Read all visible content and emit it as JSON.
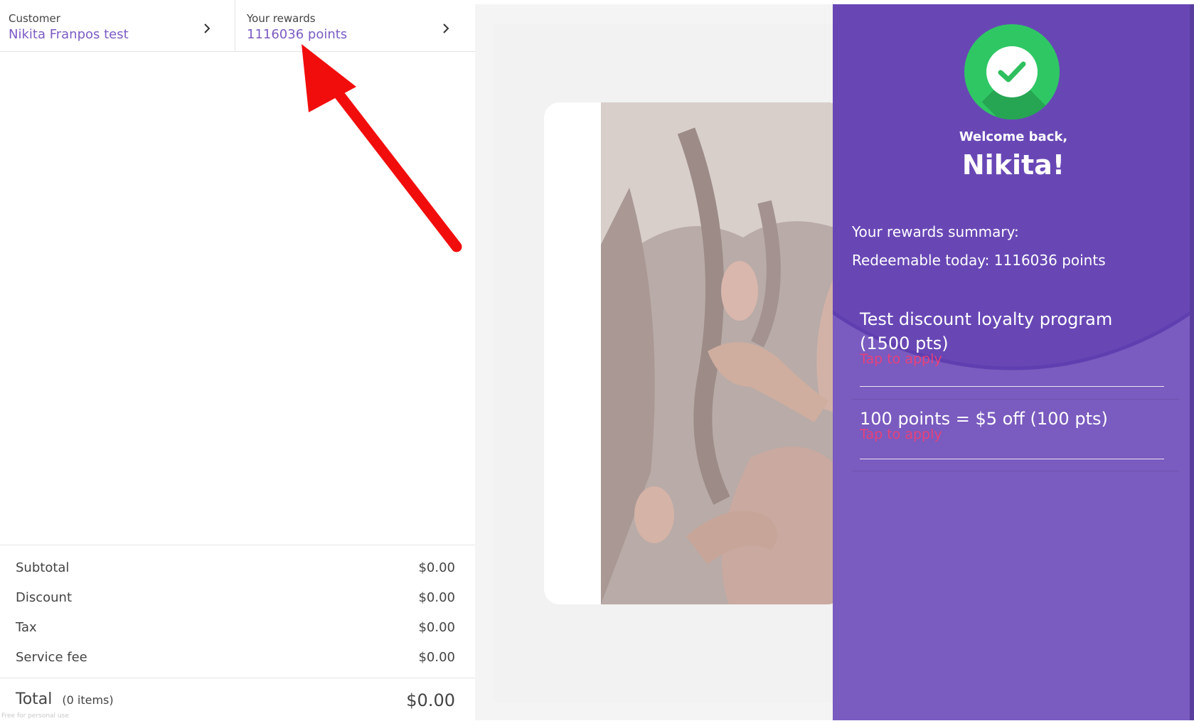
{
  "header": {
    "customer_label": "Customer",
    "customer_name": "Nikita Franpos test",
    "rewards_label": "Your rewards",
    "rewards_points": "1116036 points"
  },
  "totals": {
    "subtotal_label": "Subtotal",
    "subtotal_value": "$0.00",
    "discount_label": "Discount",
    "discount_value": "$0.00",
    "tax_label": "Tax",
    "tax_value": "$0.00",
    "service_label": "Service fee",
    "service_value": "$0.00",
    "total_label": "Total",
    "total_items": "(0 items)",
    "total_value": "$0.00"
  },
  "footer_note": "Free for personal use",
  "panel": {
    "welcome": "Welcome back,",
    "name": "Nikita!",
    "summary": "Your rewards summary:",
    "redeemable": "Redeemable today: 1116036 points",
    "rewards": [
      {
        "title": "Test discount loyalty program (1500 pts)",
        "action": "Tap to apply"
      },
      {
        "title": "100 points = $5 off (100 pts)",
        "action": "Tap to apply"
      }
    ]
  },
  "colors": {
    "accent": "#7b5bc4",
    "panel_bg": "#7a5bbf",
    "panel_arc": "#5f3fb0",
    "success": "#2fc764",
    "tap_text": "#e8417a",
    "annotation_arrow": "#f20d0d"
  },
  "icons": {
    "header_chevron": "chevron-right-icon",
    "success_badge": "checkmark-icon"
  }
}
